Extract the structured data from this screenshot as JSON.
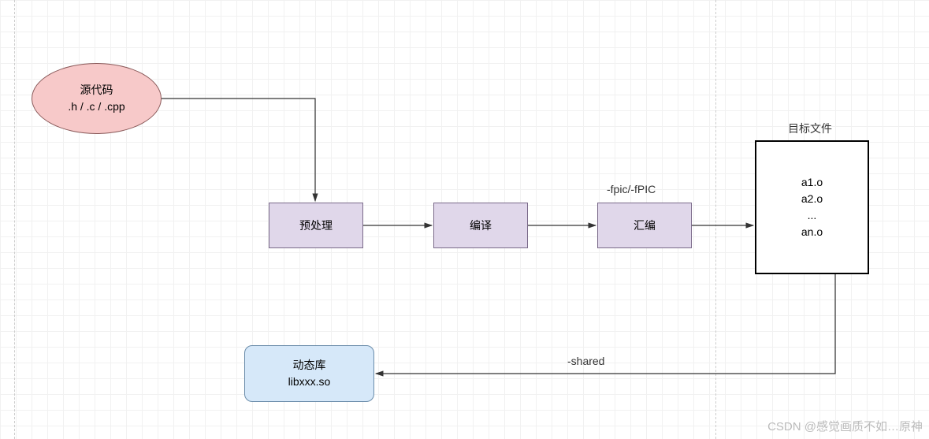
{
  "nodes": {
    "source": {
      "title": "源代码",
      "sub": ".h / .c / .cpp"
    },
    "preprocess": {
      "label": "预处理"
    },
    "compile": {
      "label": "编译"
    },
    "assemble": {
      "label": "汇编"
    },
    "target": {
      "title": "目标文件",
      "lines": [
        "a1.o",
        "a2.o",
        "...",
        "an.o"
      ]
    },
    "lib": {
      "title": "动态库",
      "sub": "libxxx.so"
    }
  },
  "edgeLabels": {
    "fpic": "-fpic/-fPIC",
    "shared": "-shared"
  },
  "watermark": "CSDN @感觉画质不如…原神"
}
